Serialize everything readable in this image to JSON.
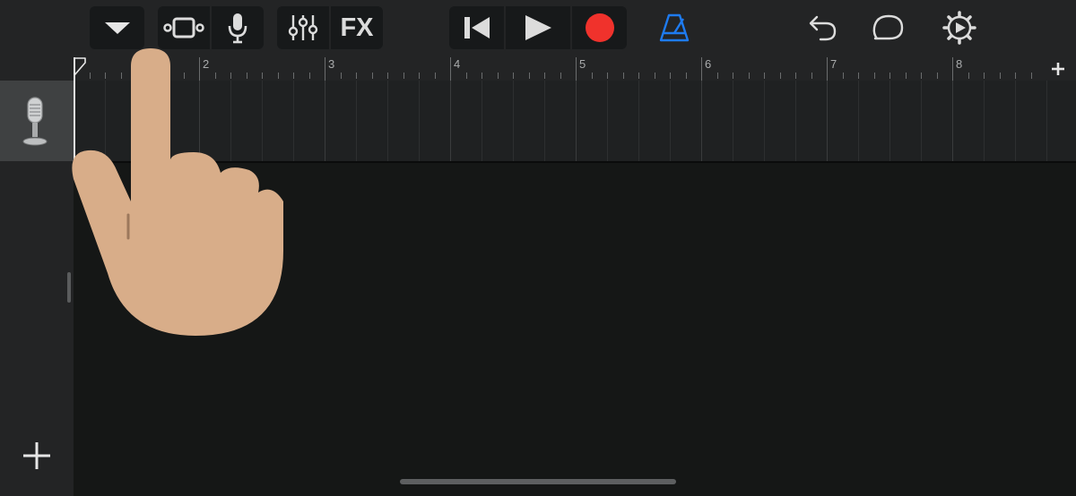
{
  "toolbar": {
    "fx_label": "FX"
  },
  "ruler": {
    "bars": [
      "2",
      "3",
      "4",
      "5",
      "6",
      "7",
      "8"
    ]
  },
  "colors": {
    "record": "#f0322c",
    "metronome": "#1e7bf0",
    "hand": "#d8ad89"
  },
  "icons": {
    "menu": "chevron-down-icon",
    "tracks_view": "tracks-view-icon",
    "microphone": "microphone-icon",
    "mixer": "mixer-sliders-icon",
    "rewind": "go-to-start-icon",
    "play": "play-icon",
    "record": "record-icon",
    "metronome": "metronome-icon",
    "undo": "undo-icon",
    "loop": "loop-browser-icon",
    "settings": "settings-gear-icon",
    "add_section": "plus-icon",
    "add_track": "plus-icon",
    "track_instrument": "vintage-microphone-icon",
    "tap_gesture": "pointing-hand-icon"
  }
}
